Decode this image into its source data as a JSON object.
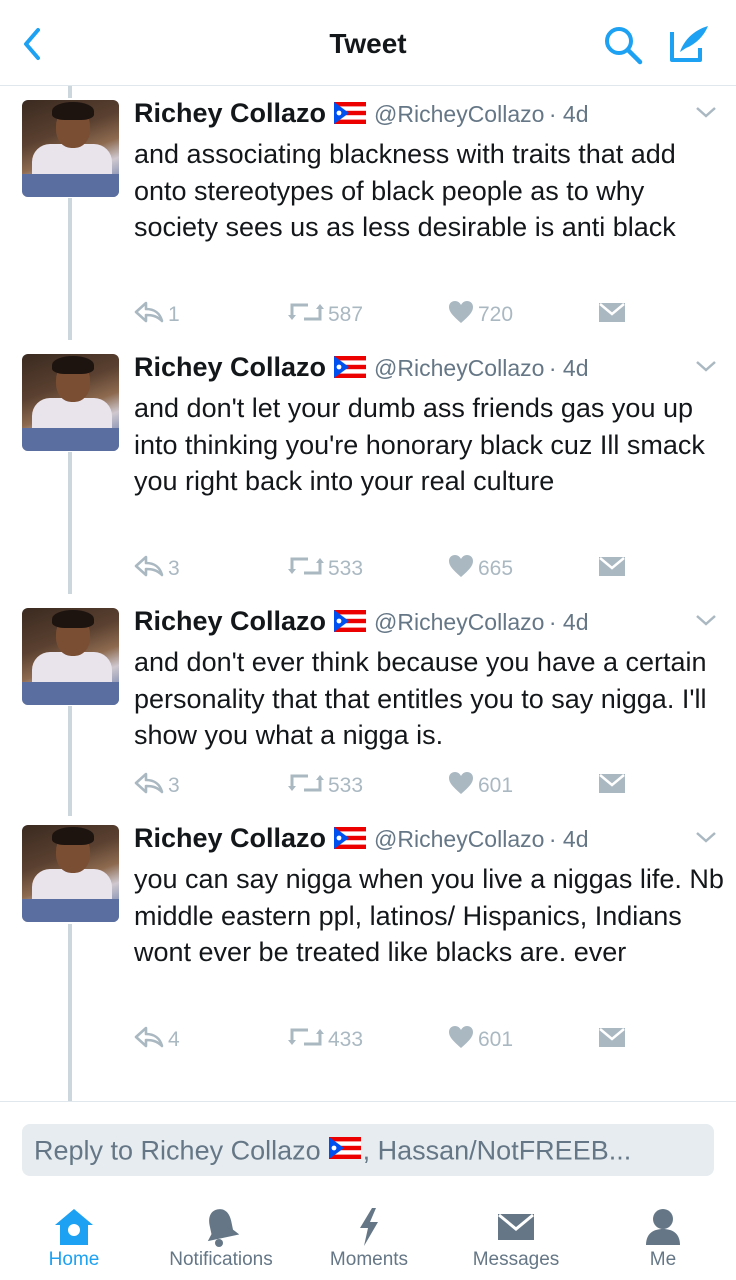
{
  "header": {
    "title": "Tweet",
    "back_icon": "chevron-left-icon",
    "search_icon": "search-icon",
    "compose_icon": "compose-icon"
  },
  "colors": {
    "accent": "#1da1f2",
    "text": "#14171a",
    "muted": "#657786",
    "icon_muted": "#aab8c2"
  },
  "tweets": [
    {
      "name": "Richey Collazo",
      "handle": "@RicheyCollazo",
      "time": "· 4d",
      "text": "and associating blackness with traits that add onto stereotypes of black people as to why society sees us as less desirable is anti black",
      "replies": "1",
      "retweets": "587",
      "likes": "720"
    },
    {
      "name": "Richey Collazo",
      "handle": "@RicheyCollazo",
      "time": "· 4d",
      "text": "and don't let your dumb ass friends gas you up into thinking you're honorary black cuz Ill smack you right back into your real culture",
      "replies": "3",
      "retweets": "533",
      "likes": "665"
    },
    {
      "name": "Richey Collazo",
      "handle": "@RicheyCollazo",
      "time": "· 4d",
      "text": "and don't ever think because you have a certain personality that that entitles you to say nigga. I'll show you what a nigga is.",
      "replies": "3",
      "retweets": "533",
      "likes": "601"
    },
    {
      "name": "Richey Collazo",
      "handle": "@RicheyCollazo",
      "time": "· 4d",
      "text": "you can say nigga when you live a niggas life. Nb middle eastern ppl,  latinos/ Hispanics, Indians wont ever be treated like blacks are. ever",
      "replies": "4",
      "retweets": "433",
      "likes": "601"
    }
  ],
  "reply_bar": {
    "prefix": "Reply to Richey Collazo",
    "suffix": ", Hassan/NotFREEB..."
  },
  "tabs": [
    {
      "label": "Home",
      "icon": "home-icon",
      "active": true
    },
    {
      "label": "Notifications",
      "icon": "bell-icon",
      "active": false
    },
    {
      "label": "Moments",
      "icon": "lightning-icon",
      "active": false
    },
    {
      "label": "Messages",
      "icon": "envelope-icon",
      "active": false
    },
    {
      "label": "Me",
      "icon": "person-icon",
      "active": false
    }
  ]
}
